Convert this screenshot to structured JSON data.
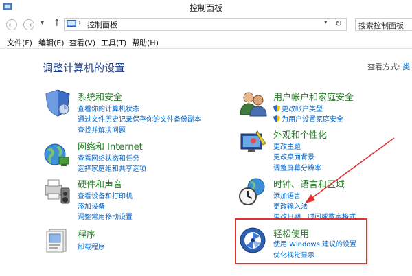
{
  "window": {
    "title": "控制面板"
  },
  "address_bar": {
    "breadcrumb": "控制面板",
    "refresh_icon": "refresh-icon"
  },
  "search": {
    "placeholder": "搜索控制面板"
  },
  "menu": {
    "items": [
      "文件(F)",
      "编辑(E)",
      "查看(V)",
      "工具(T)",
      "帮助(H)"
    ]
  },
  "page": {
    "heading": "调整计算机的设置",
    "view_by_label": "查看方式:",
    "view_by_value": "类"
  },
  "categories": {
    "system": {
      "title": "系统和安全",
      "links": [
        "查看你的计算机状态",
        "通过文件历史记录保存你的文件备份副本",
        "查找并解决问题"
      ],
      "icon": "system-security-icon"
    },
    "network": {
      "title": "网络和 Internet",
      "links": [
        "查看网络状态和任务",
        "选择家庭组和共享选项"
      ],
      "icon": "network-internet-icon"
    },
    "hardware": {
      "title": "硬件和声音",
      "links": [
        "查看设备和打印机",
        "添加设备",
        "调整常用移动设置"
      ],
      "icon": "hardware-sound-icon"
    },
    "programs": {
      "title": "程序",
      "links": [
        "卸载程序"
      ],
      "icon": "programs-icon"
    },
    "user": {
      "title": "用户帐户和家庭安全",
      "links": [
        "更改帐户类型",
        "为用户设置家庭安全"
      ],
      "icon": "user-accounts-icon"
    },
    "appearance": {
      "title": "外观和个性化",
      "links": [
        "更改主题",
        "更改桌面背景",
        "调整屏幕分辨率"
      ],
      "icon": "appearance-icon"
    },
    "clock": {
      "title": "时钟、语言和区域",
      "links": [
        "添加语言",
        "更改输入法",
        "更改日期、时间或数字格式"
      ],
      "icon": "clock-region-icon"
    },
    "ease": {
      "title": "轻松使用",
      "links": [
        "使用 Windows 建议的设置",
        "优化视觉显示"
      ],
      "icon": "ease-of-access-icon"
    }
  },
  "annotations": {
    "highlight_color": "#e23030",
    "arrow_color": "#e23030"
  }
}
